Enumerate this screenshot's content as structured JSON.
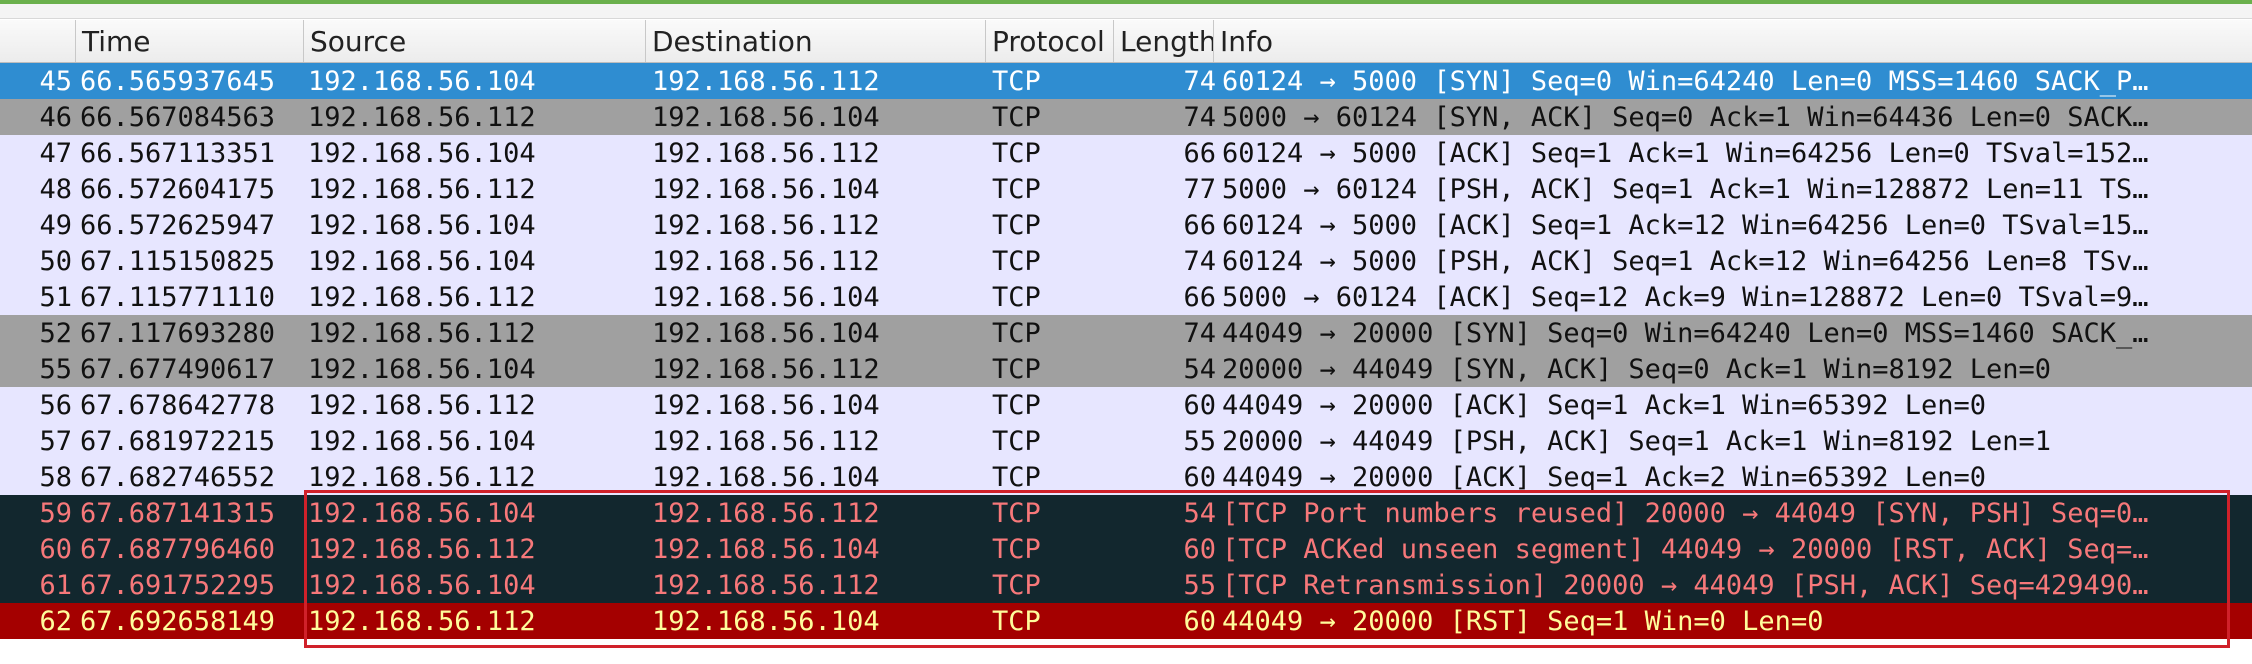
{
  "columns": {
    "no": "",
    "time": "Time",
    "source": "Source",
    "destination": "Destination",
    "protocol": "Protocol",
    "length": "Length",
    "info": "Info"
  },
  "colors": {
    "selected_bg": "#2f8dd1",
    "selected_fg": "#ffffff",
    "gray_bg": "#a0a0a0",
    "lavender_bg": "#e7e6ff",
    "dark_bg": "#12272e",
    "dark_fg": "#f7787a",
    "red_bg": "#a40000",
    "red_fg": "#fffc9c",
    "highlight_border": "#d0212a"
  },
  "packets": [
    {
      "no": "45",
      "time": "66.565937645",
      "source": "192.168.56.104",
      "destination": "192.168.56.112",
      "protocol": "TCP",
      "length": "74",
      "info": "60124 → 5000 [SYN] Seq=0 Win=64240 Len=0 MSS=1460 SACK_P…",
      "style": "selected"
    },
    {
      "no": "46",
      "time": "66.567084563",
      "source": "192.168.56.112",
      "destination": "192.168.56.104",
      "protocol": "TCP",
      "length": "74",
      "info": "5000 → 60124 [SYN, ACK] Seq=0 Ack=1 Win=64436 Len=0 SACK…",
      "style": "gray"
    },
    {
      "no": "47",
      "time": "66.567113351",
      "source": "192.168.56.104",
      "destination": "192.168.56.112",
      "protocol": "TCP",
      "length": "66",
      "info": "60124 → 5000 [ACK] Seq=1 Ack=1 Win=64256 Len=0 TSval=152…",
      "style": "lavender"
    },
    {
      "no": "48",
      "time": "66.572604175",
      "source": "192.168.56.112",
      "destination": "192.168.56.104",
      "protocol": "TCP",
      "length": "77",
      "info": "5000 → 60124 [PSH, ACK] Seq=1 Ack=1 Win=128872 Len=11 TS…",
      "style": "lavender"
    },
    {
      "no": "49",
      "time": "66.572625947",
      "source": "192.168.56.104",
      "destination": "192.168.56.112",
      "protocol": "TCP",
      "length": "66",
      "info": "60124 → 5000 [ACK] Seq=1 Ack=12 Win=64256 Len=0 TSval=15…",
      "style": "lavender"
    },
    {
      "no": "50",
      "time": "67.115150825",
      "source": "192.168.56.104",
      "destination": "192.168.56.112",
      "protocol": "TCP",
      "length": "74",
      "info": "60124 → 5000 [PSH, ACK] Seq=1 Ack=12 Win=64256 Len=8 TSv…",
      "style": "lavender"
    },
    {
      "no": "51",
      "time": "67.115771110",
      "source": "192.168.56.112",
      "destination": "192.168.56.104",
      "protocol": "TCP",
      "length": "66",
      "info": "5000 → 60124 [ACK] Seq=12 Ack=9 Win=128872 Len=0 TSval=9…",
      "style": "lavender"
    },
    {
      "no": "52",
      "time": "67.117693280",
      "source": "192.168.56.112",
      "destination": "192.168.56.104",
      "protocol": "TCP",
      "length": "74",
      "info": "44049 → 20000 [SYN] Seq=0 Win=64240 Len=0 MSS=1460 SACK_…",
      "style": "gray"
    },
    {
      "no": "55",
      "time": "67.677490617",
      "source": "192.168.56.104",
      "destination": "192.168.56.112",
      "protocol": "TCP",
      "length": "54",
      "info": "20000 → 44049 [SYN, ACK] Seq=0 Ack=1 Win=8192 Len=0",
      "style": "gray"
    },
    {
      "no": "56",
      "time": "67.678642778",
      "source": "192.168.56.112",
      "destination": "192.168.56.104",
      "protocol": "TCP",
      "length": "60",
      "info": "44049 → 20000 [ACK] Seq=1 Ack=1 Win=65392 Len=0",
      "style": "lavender"
    },
    {
      "no": "57",
      "time": "67.681972215",
      "source": "192.168.56.104",
      "destination": "192.168.56.112",
      "protocol": "TCP",
      "length": "55",
      "info": "20000 → 44049 [PSH, ACK] Seq=1 Ack=1 Win=8192 Len=1",
      "style": "lavender"
    },
    {
      "no": "58",
      "time": "67.682746552",
      "source": "192.168.56.112",
      "destination": "192.168.56.104",
      "protocol": "TCP",
      "length": "60",
      "info": "44049 → 20000 [ACK] Seq=1 Ack=2 Win=65392 Len=0",
      "style": "lavender"
    },
    {
      "no": "59",
      "time": "67.687141315",
      "source": "192.168.56.104",
      "destination": "192.168.56.112",
      "protocol": "TCP",
      "length": "54",
      "info": "[TCP Port numbers reused] 20000 → 44049 [SYN, PSH] Seq=0…",
      "style": "dark"
    },
    {
      "no": "60",
      "time": "67.687796460",
      "source": "192.168.56.112",
      "destination": "192.168.56.104",
      "protocol": "TCP",
      "length": "60",
      "info": "[TCP ACKed unseen segment] 44049 → 20000 [RST, ACK] Seq=…",
      "style": "dark"
    },
    {
      "no": "61",
      "time": "67.691752295",
      "source": "192.168.56.104",
      "destination": "192.168.56.112",
      "protocol": "TCP",
      "length": "55",
      "info": "[TCP Retransmission] 20000 → 44049 [PSH, ACK] Seq=429490…",
      "style": "dark"
    },
    {
      "no": "62",
      "time": "67.692658149",
      "source": "192.168.56.112",
      "destination": "192.168.56.104",
      "protocol": "TCP",
      "length": "60",
      "info": "44049 → 20000 [RST] Seq=1 Win=0 Len=0",
      "style": "red"
    }
  ]
}
